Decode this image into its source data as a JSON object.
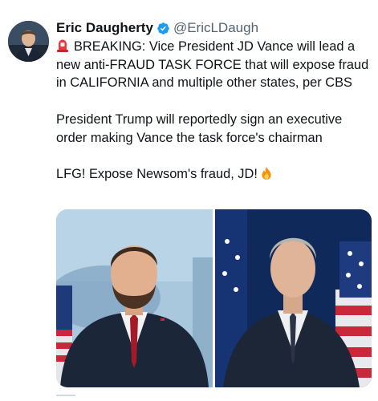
{
  "tweet": {
    "author_name": "Eric Daugherty",
    "author_handle": "@EricLDaugh",
    "paragraph_1_emoji": "🚨",
    "paragraph_1": "BREAKING: Vice President JD Vance will lead a new anti-FRAUD TASK FORCE that will expose fraud in CALIFORNIA and multiple other states, per CBS",
    "paragraph_2": "President Trump will reportedly sign an executive order making Vance the task force's chairman",
    "paragraph_3": "LFG! Expose Newsom's fraud, JD!",
    "paragraph_3_emoji": "🔥"
  },
  "icons": {
    "verified": "verified-badge-icon",
    "siren": "police-siren-icon",
    "fire": "fire-icon"
  },
  "colors": {
    "verified_blue": "#1d9bf0",
    "handle_gray": "#536471",
    "text": "#0f1419"
  }
}
